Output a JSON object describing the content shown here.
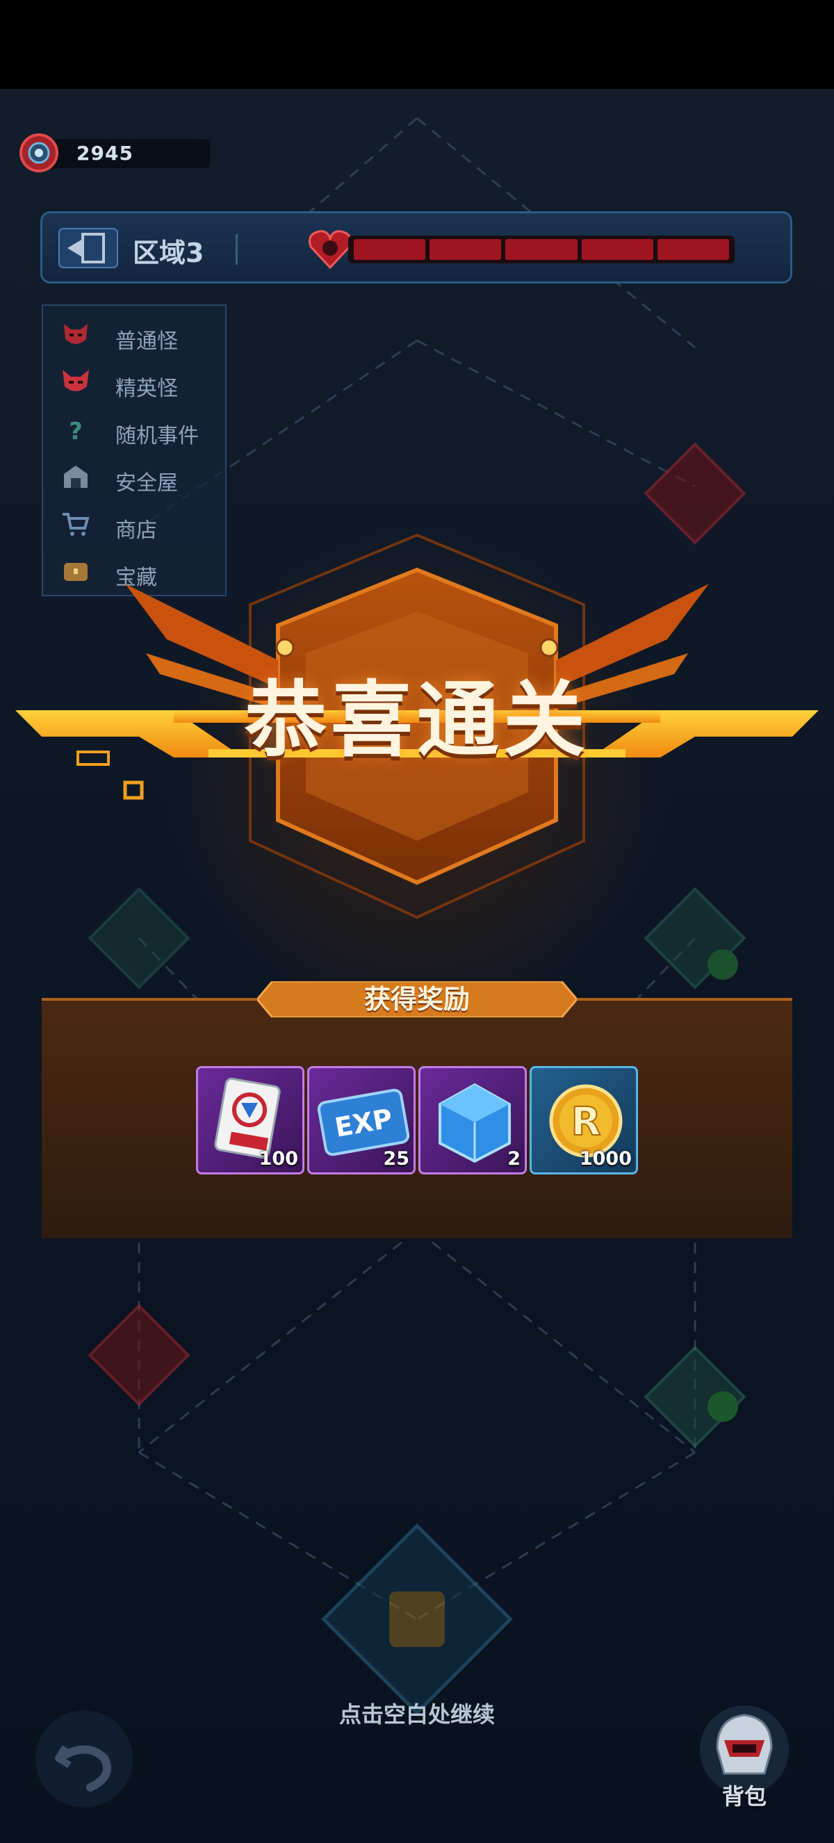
{
  "currency": {
    "value": "2945",
    "icon": "gear-icon"
  },
  "zone": {
    "name": "区域3",
    "hp_segments": 5
  },
  "legend": {
    "items": [
      {
        "label": "普通怪",
        "icon": "demon-mask-icon"
      },
      {
        "label": "精英怪",
        "icon": "elite-demon-icon"
      },
      {
        "label": "随机事件",
        "icon": "question-icon"
      },
      {
        "label": "安全屋",
        "icon": "safehouse-icon"
      },
      {
        "label": "商店",
        "icon": "shop-cart-icon"
      },
      {
        "label": "宝藏",
        "icon": "treasure-icon"
      }
    ]
  },
  "banner": {
    "title": "恭喜通关"
  },
  "rewards": {
    "title": "获得奖励",
    "items": [
      {
        "icon": "card-icon",
        "qty": "100",
        "rarity": "purple"
      },
      {
        "icon": "exp-chip-icon",
        "qty": "25",
        "rarity": "purple"
      },
      {
        "icon": "blue-cube-icon",
        "qty": "2",
        "rarity": "purple"
      },
      {
        "icon": "gold-coin-icon",
        "qty": "1000",
        "rarity": "blue"
      }
    ]
  },
  "hint": "点击空白处继续",
  "bag": {
    "label": "背包"
  },
  "colors": {
    "accent_orange": "#f39a1e",
    "hp_red": "#a01522",
    "panel_brown": "#3a210f"
  }
}
